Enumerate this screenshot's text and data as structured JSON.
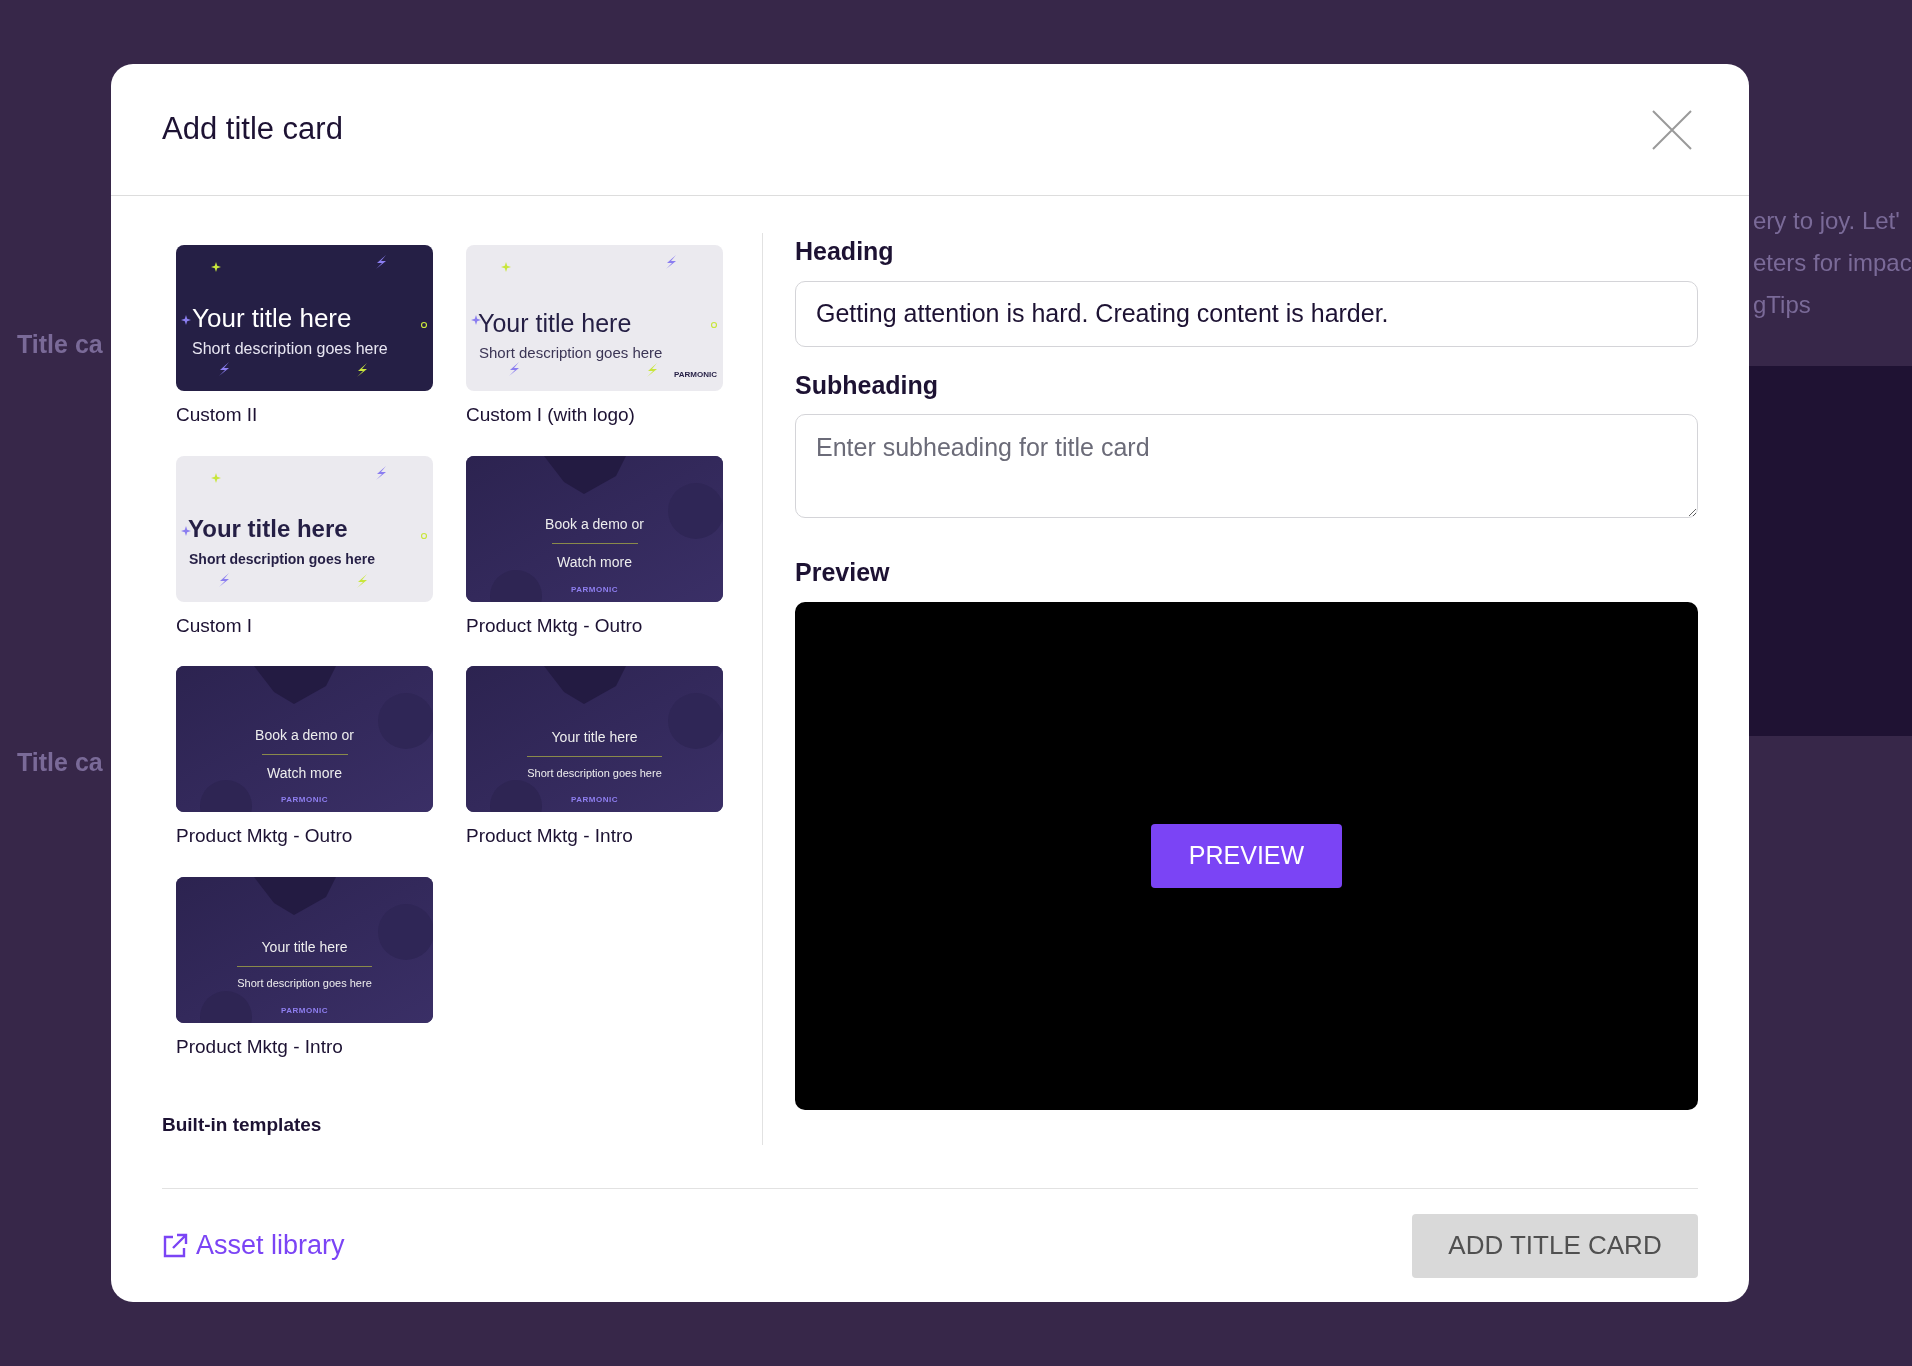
{
  "background": {
    "left_headings": [
      "Title ca",
      "Title ca"
    ],
    "right_lines": [
      "ery to joy. Let'",
      "eters for impac",
      "gTips"
    ]
  },
  "modal": {
    "title": "Add title card",
    "templates": [
      {
        "name": "Custom II",
        "kind": "dark",
        "title": "Your title here",
        "subtitle": "Short description goes here"
      },
      {
        "name": "Custom I (with logo)",
        "kind": "light",
        "title": "Your title here",
        "subtitle": "Short description goes here",
        "logo": "PARMONIC"
      },
      {
        "name": "Custom I",
        "kind": "bold",
        "title": "Your title here",
        "subtitle": "Short description goes here"
      },
      {
        "name": "Product Mktg - Outro",
        "kind": "product",
        "title": "Book a demo or",
        "subtitle": "Watch more",
        "logo": "PARMONIC"
      },
      {
        "name": "Product Mktg - Outro",
        "kind": "product",
        "title": "Book a demo or",
        "subtitle": "Watch more",
        "logo": "PARMONIC"
      },
      {
        "name": "Product Mktg - Intro",
        "kind": "product",
        "title": "Your title here",
        "subtitle": "Short description goes here",
        "logo": "PARMONIC"
      },
      {
        "name": "Product Mktg - Intro",
        "kind": "product",
        "title": "Your title here",
        "subtitle": "Short description goes here",
        "logo": "PARMONIC"
      }
    ],
    "templates_caption": "Built-in templates",
    "form": {
      "heading_label": "Heading",
      "heading_value": "Getting attention is hard. Creating content is harder.",
      "subheading_label": "Subheading",
      "subheading_placeholder": "Enter subheading for title card",
      "preview_label": "Preview",
      "preview_button": "PREVIEW"
    },
    "footer": {
      "asset_link": "Asset library",
      "add_button": "ADD TITLE CARD",
      "add_disabled": true
    }
  }
}
